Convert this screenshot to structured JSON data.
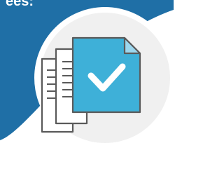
{
  "banner": {
    "text": "ees:",
    "color": "#1f6fa6"
  },
  "illustration": {
    "circle_color": "#f0f0f0",
    "ring_color": "#ffffff",
    "document_color": "#3eb0d8",
    "document_fold_color": "#9dd7ee",
    "paper_color": "#ffffff",
    "outline_color": "#5a5a5a",
    "icons": [
      "stacked-papers-icon",
      "document-icon",
      "checkmark-icon"
    ]
  }
}
